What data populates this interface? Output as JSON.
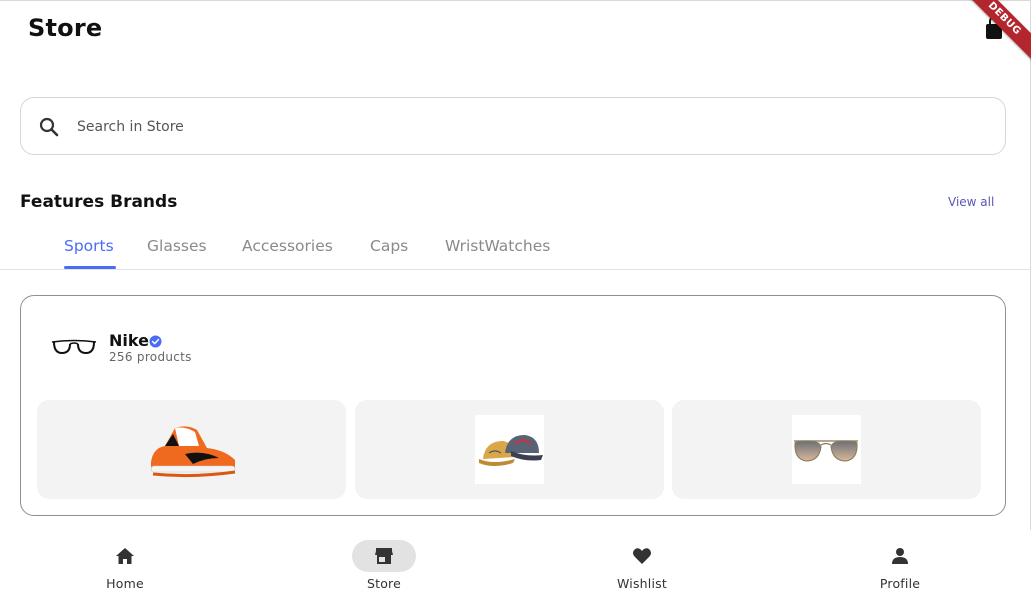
{
  "appbar": {
    "title": "Store",
    "cart_icon": "shopping-bag-icon",
    "debug_banner": "DEBUG"
  },
  "search": {
    "placeholder": "Search in Store",
    "value": "",
    "icon": "search-icon"
  },
  "featured": {
    "title": "Features Brands",
    "view_all": "View all",
    "tabs": [
      {
        "label": "Sports",
        "active": true
      },
      {
        "label": "Glasses",
        "active": false
      },
      {
        "label": "Accessories",
        "active": false
      },
      {
        "label": "Caps",
        "active": false
      },
      {
        "label": "WristWatches",
        "active": false
      }
    ]
  },
  "brand": {
    "name": "Nike",
    "verified_icon": "verified-badge-icon",
    "count": "256 products",
    "logo_icon": "glasses-logo-icon",
    "products": [
      {
        "icon": "sneaker-image"
      },
      {
        "icon": "caps-image"
      },
      {
        "icon": "sunglasses-image"
      }
    ]
  },
  "nav": {
    "items": [
      {
        "label": "Home",
        "icon": "home-icon",
        "active": false
      },
      {
        "label": "Store",
        "icon": "store-icon",
        "active": true
      },
      {
        "label": "Wishlist",
        "icon": "heart-icon",
        "active": false
      },
      {
        "label": "Profile",
        "icon": "person-icon",
        "active": false
      }
    ]
  },
  "colors": {
    "accent": "#4a6cf7",
    "link": "#5a55b5",
    "debug": "#b3262d",
    "verified": "#4a6cf7"
  }
}
